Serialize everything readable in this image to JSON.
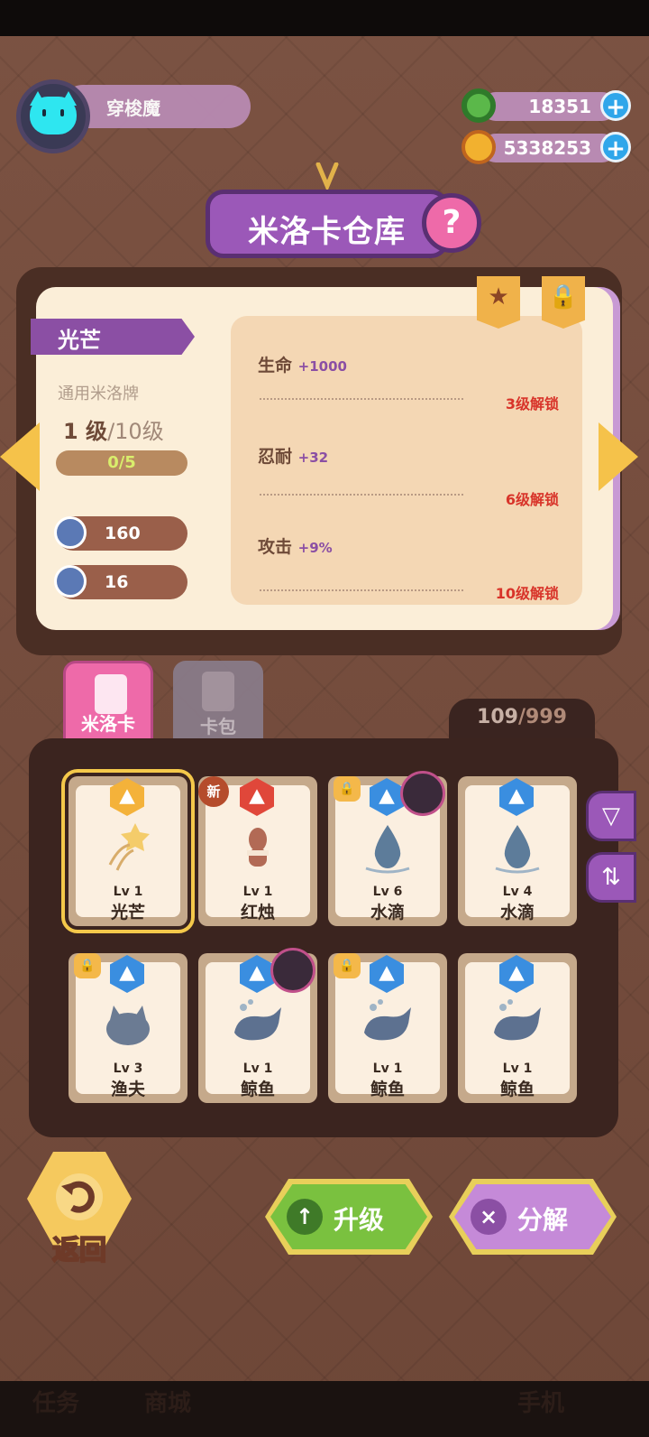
{
  "player": {
    "name": "穿梭魔"
  },
  "currency": [
    {
      "name": "green-donut",
      "value": "18351",
      "color": "#5bb84a"
    },
    {
      "name": "gold-planet",
      "value": "5338253",
      "color": "#f2b12f"
    }
  ],
  "title": "米洛卡仓库",
  "help_label": "?",
  "detail": {
    "name": "光芒",
    "type": "通用米洛牌",
    "level_current": "1 级",
    "level_max": "/10级",
    "xp": "0/5",
    "stats": [
      {
        "icon": "bell-icon",
        "value": "160"
      },
      {
        "icon": "anchor-icon",
        "value": "16"
      }
    ],
    "attributes": [
      {
        "name": "生命",
        "bonus": "+1000",
        "unlock": "3级解锁"
      },
      {
        "name": "忍耐",
        "bonus": "+32",
        "unlock": "6级解锁"
      },
      {
        "name": "攻击",
        "bonus": "+9%",
        "unlock": "10级解锁"
      }
    ]
  },
  "tabs": [
    {
      "label": "米洛卡",
      "active": true
    },
    {
      "label": "卡包",
      "active": false
    }
  ],
  "collection": {
    "count": "109",
    "max": "/999"
  },
  "cards": [
    {
      "lv": "Lv 1",
      "name": "光芒",
      "element": "#f4b23a"
    },
    {
      "lv": "Lv 1",
      "name": "红烛",
      "element": "#e0473a",
      "tag": "新"
    },
    {
      "lv": "Lv 6",
      "name": "水滴",
      "element": "#3a8ee0"
    },
    {
      "lv": "Lv 4",
      "name": "水滴",
      "element": "#3a8ee0"
    },
    {
      "lv": "Lv 3",
      "name": "渔夫",
      "element": "#3a8ee0"
    },
    {
      "lv": "Lv 1",
      "name": "鲸鱼",
      "element": "#3a8ee0"
    },
    {
      "lv": "Lv 1",
      "name": "鲸鱼",
      "element": "#3a8ee0"
    },
    {
      "lv": "Lv 1",
      "name": "鲸鱼",
      "element": "#3a8ee0"
    }
  ],
  "buttons": {
    "back": "返回",
    "upgrade": "升级",
    "decompose": "分解"
  },
  "bottom_nav_hidden": [
    "任务",
    "商城",
    "手机"
  ]
}
